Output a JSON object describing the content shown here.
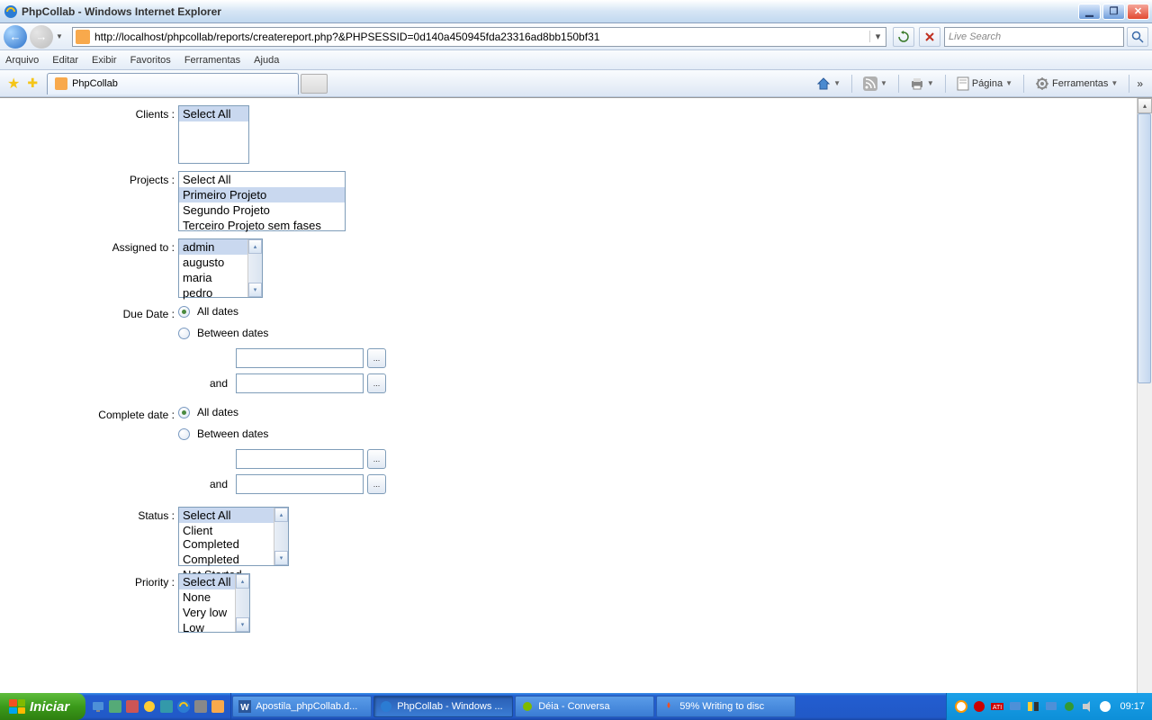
{
  "titlebar": {
    "text": "PhpCollab - Windows Internet Explorer"
  },
  "navbar": {
    "url": "http://localhost/phpcollab/reports/createreport.php?&PHPSESSID=0d140a450945fda23316ad8bb150bf31",
    "search_placeholder": "Live Search"
  },
  "menubar": {
    "items": [
      "Arquivo",
      "Editar",
      "Exibir",
      "Favoritos",
      "Ferramentas",
      "Ajuda"
    ]
  },
  "tab": {
    "title": "PhpCollab"
  },
  "toolbar_right": {
    "pagina": "Página",
    "ferramentas": "Ferramentas"
  },
  "form": {
    "clients": {
      "label": "Clients :",
      "options": [
        "Select All"
      ],
      "selected": [
        0
      ]
    },
    "projects": {
      "label": "Projects :",
      "options": [
        "Select All",
        "Primeiro Projeto",
        "Segundo Projeto",
        "Terceiro Projeto sem fases"
      ],
      "selected": [
        1
      ]
    },
    "assigned": {
      "label": "Assigned to :",
      "options": [
        "admin",
        "augusto",
        "maria",
        "pedro"
      ],
      "selected": [
        0
      ]
    },
    "duedate": {
      "label": "Due Date :",
      "all": "All dates",
      "between": "Between dates",
      "and": "and",
      "btn": "..."
    },
    "completedate": {
      "label": "Complete date :",
      "all": "All dates",
      "between": "Between dates",
      "and": "and",
      "btn": "..."
    },
    "status": {
      "label": "Status :",
      "options": [
        "Select All",
        "Client Completed",
        "Completed",
        "Not Started"
      ],
      "selected": [
        0
      ]
    },
    "priority": {
      "label": "Priority :",
      "options": [
        "Select All",
        "None",
        "Very low",
        "Low"
      ],
      "selected": [
        0
      ]
    }
  },
  "taskbar": {
    "start": "Iniciar",
    "items": [
      {
        "label": "Apostila_phpCollab.d..."
      },
      {
        "label": "PhpCollab - Windows ...",
        "active": true
      },
      {
        "label": "Déia - Conversa"
      },
      {
        "label": "59% Writing to disc"
      }
    ],
    "time": "09:17"
  }
}
